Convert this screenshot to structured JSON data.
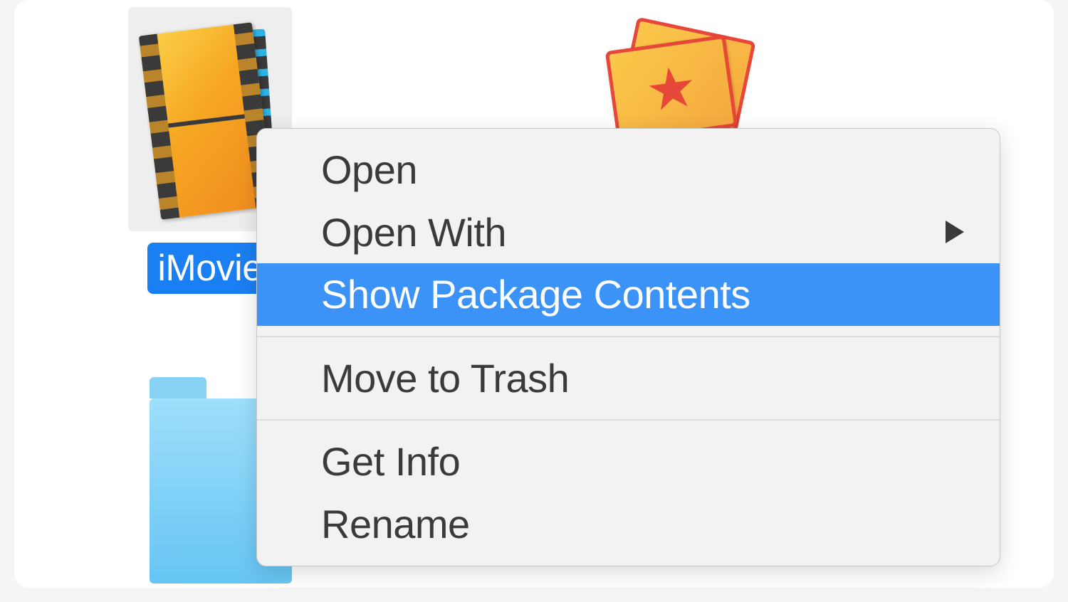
{
  "files": {
    "selected": {
      "label": "iMovie",
      "icon": "imovie-library-icon"
    },
    "background_icons": {
      "ticket": "theater-ticket-icon",
      "folder": "folder-icon"
    }
  },
  "context_menu": {
    "items": [
      {
        "label": "Open",
        "submenu": false,
        "highlighted": false
      },
      {
        "label": "Open With",
        "submenu": true,
        "highlighted": false
      },
      {
        "label": "Show Package Contents",
        "submenu": false,
        "highlighted": true
      }
    ],
    "items2": [
      {
        "label": "Move to Trash",
        "submenu": false,
        "highlighted": false
      }
    ],
    "items3": [
      {
        "label": "Get Info",
        "submenu": false,
        "highlighted": false
      },
      {
        "label": "Rename",
        "submenu": false,
        "highlighted": false
      }
    ]
  },
  "colors": {
    "selection_blue": "#1a7ff2",
    "menu_highlight": "#3b93f7"
  }
}
